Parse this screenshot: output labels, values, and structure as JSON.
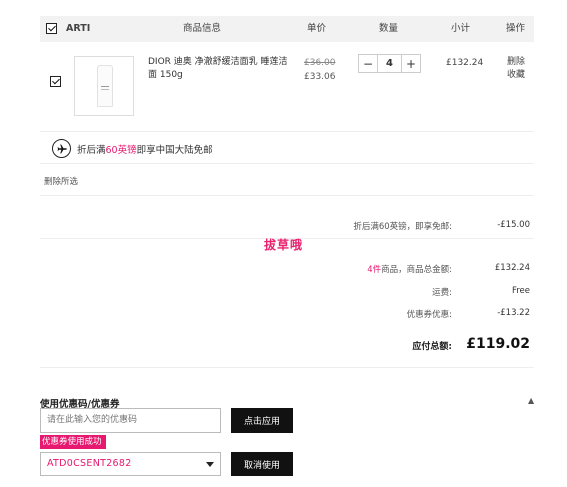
{
  "header": {
    "brand": "ARTI",
    "product_info": "商品信息",
    "unit_price": "单价",
    "quantity": "数量",
    "subtotal": "小计",
    "actions": "操作"
  },
  "item": {
    "name": "DIOR 迪奥 净澈舒缓洁面乳 睡莲洁面 150g",
    "old_price": "£36.00",
    "new_price": "£33.06",
    "quantity": "4",
    "minus_label": "−",
    "plus_label": "+",
    "subtotal": "£132.24",
    "delete_label": "删除",
    "favorite_label": "收藏"
  },
  "shipping": {
    "prefix": "折后满",
    "amount": "60英镑",
    "suffix": "即享中国大陆免邮"
  },
  "delete_selected": "删除所选",
  "watermark": "拔草哦",
  "summary": {
    "discount_label": "折后满60英镑，即享免邮:",
    "discount_value": "-£15.00",
    "count": "4件",
    "goods_total_label": "商品，商品总金额:",
    "goods_total_value": "£132.24",
    "shipping_label": "运费:",
    "shipping_value": "Free",
    "coupon_label": "优惠券优惠:",
    "coupon_value": "-£13.22",
    "total_label": "应付总额:",
    "total_value": "£119.02"
  },
  "coupon": {
    "title": "使用优惠码/优惠券",
    "input_placeholder": "请在此输入您的优惠码",
    "apply_button": "点击应用",
    "success_badge": "优惠券使用成功",
    "selected_code": "ATD0CSENT2682",
    "cancel_button": "取消使用"
  },
  "colors": {
    "accent": "#e6186f",
    "button_bg": "#111111",
    "header_bg": "#f2f2f2"
  }
}
